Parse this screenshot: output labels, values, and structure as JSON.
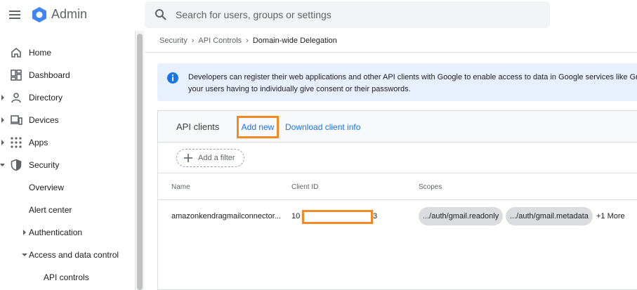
{
  "app": {
    "brand": "Admin"
  },
  "search": {
    "placeholder": "Search for users, groups or settings"
  },
  "sidebar": {
    "items": [
      {
        "label": "Home"
      },
      {
        "label": "Dashboard"
      },
      {
        "label": "Directory"
      },
      {
        "label": "Devices"
      },
      {
        "label": "Apps"
      },
      {
        "label": "Security"
      },
      {
        "label": "Overview"
      },
      {
        "label": "Alert center"
      },
      {
        "label": "Authentication"
      },
      {
        "label": "Access and data control"
      },
      {
        "label": "API controls"
      }
    ]
  },
  "breadcrumb": {
    "items": [
      "Security",
      "API Controls"
    ],
    "current": "Domain-wide Delegation"
  },
  "info": {
    "line1": "Developers can register their web applications and other API clients with Google to enable access to data in Google services like Gmail.",
    "line2": "your users having to individually give consent or their passwords."
  },
  "clients": {
    "title": "API clients",
    "add_new": "Add new",
    "download": "Download client info",
    "filter": "Add a filter",
    "columns": [
      "Name",
      "Client ID",
      "Scopes"
    ],
    "rows": [
      {
        "name": "amazonkendragmailconnector...",
        "client_id_prefix": "10",
        "client_id_suffix": "3",
        "scopes": [
          ".../auth/gmail.readonly",
          ".../auth/gmail.metadata"
        ],
        "more": "+1 More"
      }
    ]
  },
  "colors": {
    "accent": "#1a73e8",
    "highlight": "#f08a24",
    "info_bg": "#e8f0fe"
  }
}
